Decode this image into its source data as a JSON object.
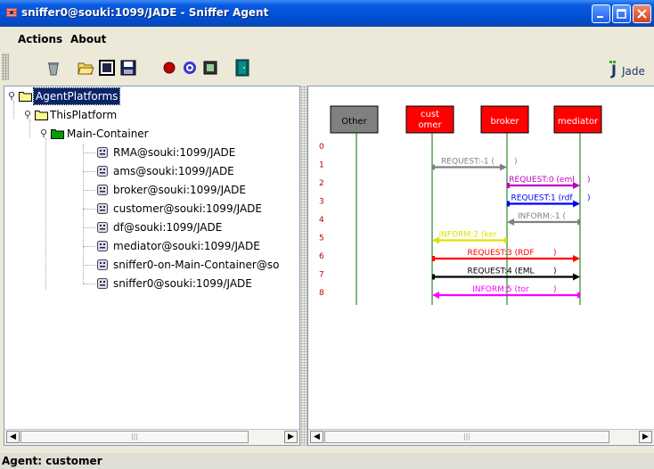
{
  "window": {
    "title": "sniffer0@souki:1099/JADE - Sniffer Agent",
    "controls": [
      "minimize-icon",
      "maximize-icon",
      "close-icon"
    ]
  },
  "menubar": {
    "items": [
      "Actions",
      "About"
    ]
  },
  "toolbar": {
    "tools": [
      "clear-canvas-icon",
      "open-icon",
      "add-agent-icon",
      "save-icon",
      "record-icon",
      "filter-icon",
      "display-icon",
      "exit-door-icon"
    ],
    "logo": "Jade"
  },
  "tree": {
    "root": "AgentPlatforms",
    "platform": "ThisPlatform",
    "container": "Main-Container",
    "agents": [
      "RMA@souki:1099/JADE",
      "ams@souki:1099/JADE",
      "broker@souki:1099/JADE",
      "customer@souki:1099/JADE",
      "df@souki:1099/JADE",
      "mediator@souki:1099/JADE",
      "sniffer0-on-Main-Container@so",
      "sniffer0@souki:1099/JADE"
    ]
  },
  "diagram": {
    "lifelines": [
      {
        "label": "Other",
        "color": "#808080"
      },
      {
        "label": "cust\nomer",
        "color": "#ff0000"
      },
      {
        "label": "broker",
        "color": "#ff0000"
      },
      {
        "label": "mediator",
        "color": "#ff0000"
      }
    ],
    "row_numbers": [
      "0",
      "1",
      "2",
      "3",
      "4",
      "5",
      "6",
      "7",
      "8"
    ],
    "messages": [
      {
        "label": "REQUEST:-1 (",
        "close": ")",
        "from": 1,
        "to": 2,
        "row": 1,
        "color": "#808080"
      },
      {
        "label": "REQUEST:0 (eml",
        "close": ")",
        "from": 2,
        "to": 3,
        "row": 2,
        "color": "#c000c0"
      },
      {
        "label": "REQUEST:1 (rdf",
        "close": ")",
        "from": 2,
        "to": 3,
        "row": 3,
        "color": "#0000ff"
      },
      {
        "label": "INFORM:-1 (",
        "close": "",
        "from": 3,
        "to": 2,
        "row": 4,
        "color": "#808080"
      },
      {
        "label": "INFORM:2 (ker",
        "close": "",
        "from": 2,
        "to": 1,
        "row": 5,
        "color": "#e0e000"
      },
      {
        "label": "REQUEST:3 (RDF",
        "close": ")",
        "from": 1,
        "to": 3,
        "row": 6,
        "color": "#ff0000"
      },
      {
        "label": "REQUEST:4 (EML",
        "close": ")",
        "from": 1,
        "to": 3,
        "row": 7,
        "color": "#000000"
      },
      {
        "label": "INFORM:5 (tor",
        "close": ")",
        "from": 3,
        "to": 1,
        "row": 8,
        "color": "#ff00ff"
      }
    ]
  },
  "status": {
    "text": "Agent: customer"
  }
}
